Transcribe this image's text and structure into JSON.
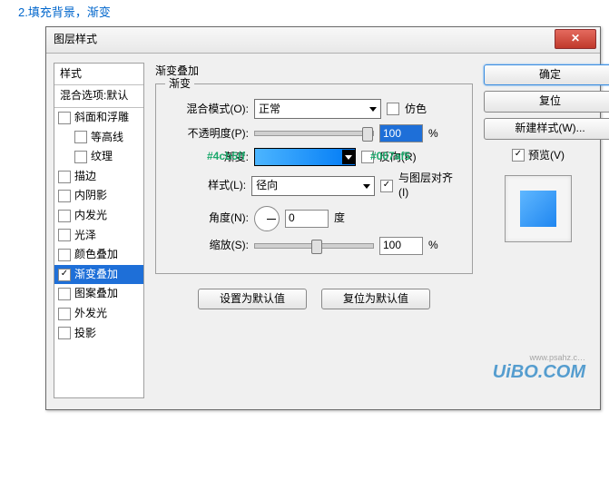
{
  "caption": "2.填充背景，渐变",
  "window": {
    "title": "图层样式",
    "close": "✕"
  },
  "styles": {
    "header": "样式",
    "sub": "混合选项:默认",
    "items": [
      {
        "label": "斜面和浮雕",
        "checked": false
      },
      {
        "label": "等高线",
        "checked": false,
        "sub": true
      },
      {
        "label": "纹理",
        "checked": false,
        "sub": true
      },
      {
        "label": "描边",
        "checked": false
      },
      {
        "label": "内阴影",
        "checked": false
      },
      {
        "label": "内发光",
        "checked": false
      },
      {
        "label": "光泽",
        "checked": false
      },
      {
        "label": "颜色叠加",
        "checked": false
      },
      {
        "label": "渐变叠加",
        "checked": true,
        "selected": true
      },
      {
        "label": "图案叠加",
        "checked": false
      },
      {
        "label": "外发光",
        "checked": false
      },
      {
        "label": "投影",
        "checked": false
      }
    ]
  },
  "panel": {
    "title": "渐变叠加",
    "legend": "渐变",
    "blendModeLabel": "混合模式(O):",
    "blendModeValue": "正常",
    "ditherLabel": "仿色",
    "opacityLabel": "不透明度(P):",
    "opacityValue": "100",
    "opacityUnit": "%",
    "gradientLabel": "渐变:",
    "reverseLabel": "反向(R)",
    "annotLeft": "#4cb5ff",
    "annotRight": "#007af5",
    "styleLabel": "样式(L):",
    "styleValue": "径向",
    "alignLabel": "与图层对齐(I)",
    "angleLabel": "角度(N):",
    "angleValue": "0",
    "angleUnit": "度",
    "scaleLabel": "缩放(S):",
    "scaleValue": "100",
    "scaleUnit": "%",
    "setDefault": "设置为默认值",
    "resetDefault": "复位为默认值"
  },
  "right": {
    "ok": "确定",
    "reset": "复位",
    "newStyle": "新建样式(W)...",
    "previewLabel": "预览(V)"
  },
  "watermark": {
    "big": "UiBO.COM",
    "small": "www.psahz.c…"
  }
}
